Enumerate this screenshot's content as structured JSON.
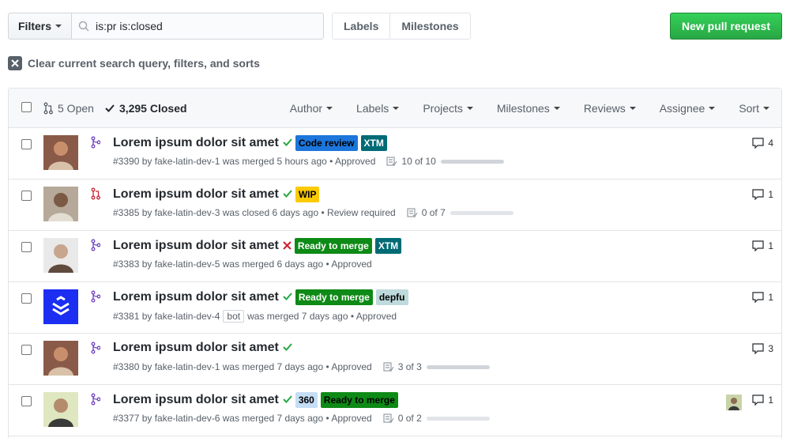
{
  "toolbar": {
    "filters_label": "Filters",
    "search_value": "is:pr is:closed",
    "labels_label": "Labels",
    "milestones_label": "Milestones",
    "new_pr_label": "New pull request"
  },
  "clear_query_text": "Clear current search query, filters, and sorts",
  "header": {
    "open_label": "5 Open",
    "closed_label": "3,295 Closed",
    "menus": [
      "Author",
      "Labels",
      "Projects",
      "Milestones",
      "Reviews",
      "Assignee",
      "Sort"
    ]
  },
  "prs": [
    {
      "title": "Lorem ipsum dolor sit amet",
      "status": "success",
      "state": "merged",
      "labels": [
        {
          "text": "Code review",
          "bg": "#1d76db",
          "fg": "#000000"
        },
        {
          "text": "XTM",
          "bg": "#006b75",
          "fg": "#ffffff"
        }
      ],
      "meta": "#3390 by fake-latin-dev-1 was merged 5 hours ago • Approved",
      "tasks": "10 of 10",
      "task_fraction": 1.0,
      "comments": "4",
      "avatar": "photo-1"
    },
    {
      "title": "Lorem ipsum dolor sit amet",
      "status": "success",
      "state": "closed",
      "labels": [
        {
          "text": "WIP",
          "bg": "#fbca04",
          "fg": "#000000"
        }
      ],
      "meta": "#3385 by fake-latin-dev-3 was closed 6 days ago • Review required",
      "tasks": "0 of 7",
      "task_fraction": 0,
      "comments": "1",
      "avatar": "photo-2"
    },
    {
      "title": "Lorem ipsum dolor sit amet",
      "status": "failure",
      "state": "merged",
      "labels": [
        {
          "text": "Ready to merge",
          "bg": "#0e8a16",
          "fg": "#ffffff"
        },
        {
          "text": "XTM",
          "bg": "#006b75",
          "fg": "#ffffff"
        }
      ],
      "meta": "#3383 by fake-latin-dev-5 was merged 6 days ago • Approved",
      "tasks": "",
      "comments": "1",
      "avatar": "photo-3"
    },
    {
      "title": "Lorem ipsum dolor sit amet",
      "status": "success",
      "state": "merged",
      "labels": [
        {
          "text": "Ready to merge",
          "bg": "#0e8a16",
          "fg": "#ffffff"
        },
        {
          "text": "depfu",
          "bg": "#bfdadc",
          "fg": "#000000"
        }
      ],
      "meta_pre": "#3381 by fake-latin-dev-4",
      "bot": "bot",
      "meta_post": "was merged 7 days ago • Approved",
      "tasks": "",
      "comments": "1",
      "avatar": "depfu-logo"
    },
    {
      "title": "Lorem ipsum dolor sit amet",
      "status": "success",
      "state": "merged",
      "labels": [],
      "meta": "#3380 by fake-latin-dev-1 was merged 7 days ago • Approved",
      "tasks": "3 of 3",
      "task_fraction": 1.0,
      "comments": "3",
      "avatar": "photo-1"
    },
    {
      "title": "Lorem ipsum dolor sit amet",
      "status": "success",
      "state": "merged",
      "labels": [
        {
          "text": "360",
          "bg": "#c5def5",
          "fg": "#000000"
        },
        {
          "text": "Ready to merge",
          "bg": "#0e8a16",
          "fg": "#000000"
        }
      ],
      "meta": "#3377 by fake-latin-dev-6 was merged 7 days ago • Approved",
      "tasks": "0 of 2",
      "task_fraction": 0,
      "comments": "1",
      "avatar": "photo-4",
      "has_assignee": true
    }
  ]
}
